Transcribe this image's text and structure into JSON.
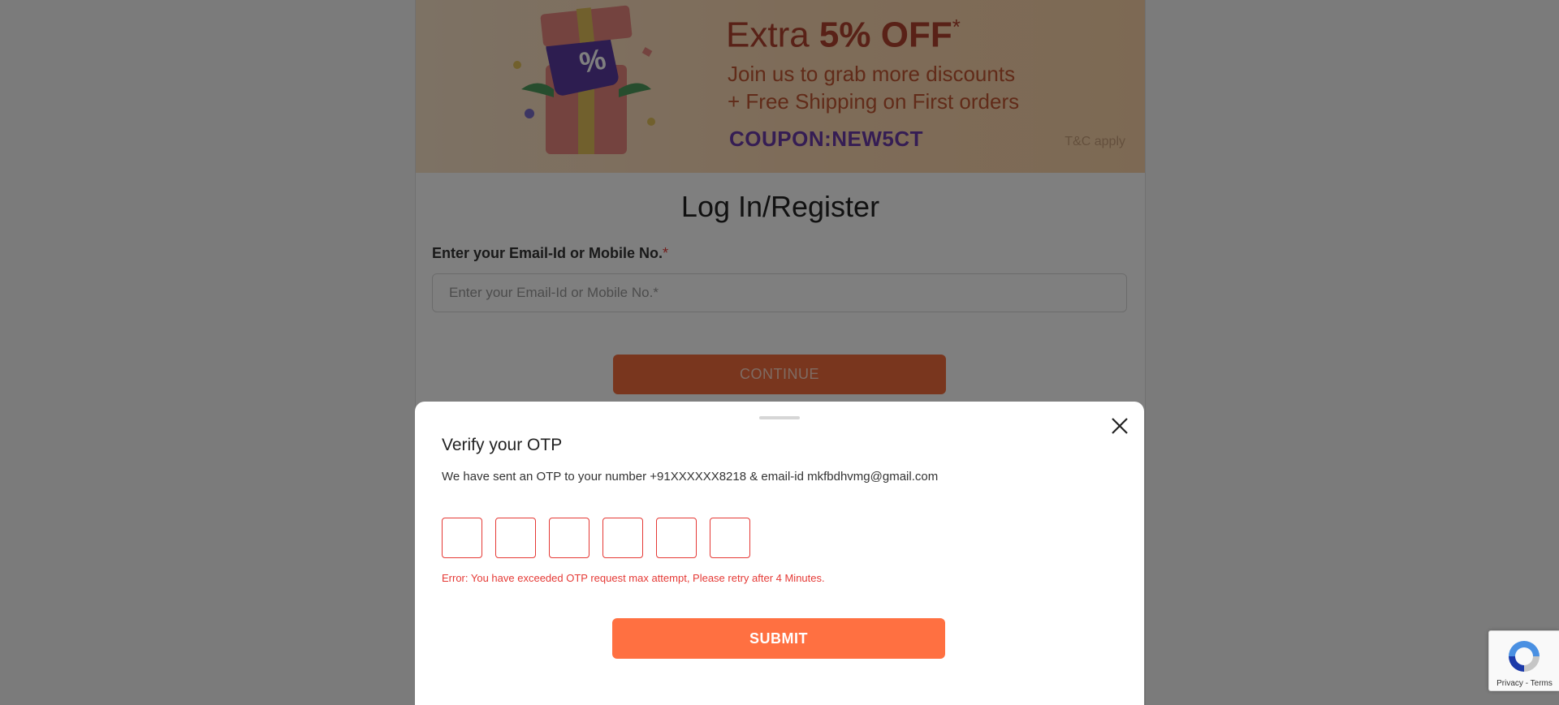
{
  "banner": {
    "title_prefix": "Extra ",
    "title_highlight": "5% OFF",
    "title_suffix": "*",
    "line1": "Join us to grab more discounts",
    "line2": "+ Free Shipping on First orders",
    "coupon": "COUPON:NEW5CT",
    "tnc": "T&C apply",
    "gift_symbol": "%"
  },
  "login": {
    "title": "Log In/Register",
    "email_label": "Enter your Email-Id or Mobile No.",
    "required_mark": "*",
    "email_placeholder": "Enter your Email-Id or Mobile No.*",
    "email_value": "",
    "continue_label": "CONTINUE"
  },
  "otp_modal": {
    "title": "Verify your OTP",
    "description": "We have sent an OTP to your number +91XXXXXX8218 & email-id mkfbdhvmg@gmail.com",
    "digits": [
      "",
      "",
      "",
      "",
      "",
      ""
    ],
    "error": "Error: You have exceeded OTP request max attempt, Please retry after 4 Minutes.",
    "submit_label": "SUBMIT",
    "close_icon": "close-icon"
  },
  "recaptcha": {
    "links": "Privacy - Terms"
  },
  "colors": {
    "accent": "#ff7041",
    "error": "#e53935",
    "coupon": "#6a3aa8",
    "banner_text": "#b2422e"
  }
}
